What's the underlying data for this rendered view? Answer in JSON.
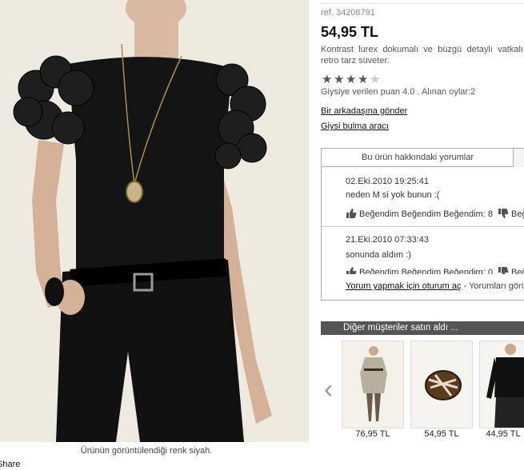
{
  "product": {
    "ref": "ref. 34208791",
    "price": "54,95 TL",
    "description": "Kontrast lurex dokumalı ve büzgü detaylı vatkalı, retro tarz süveter.",
    "rating_stars": 4,
    "rating_max": 5,
    "rating_text": "Giysiye verilen puan 4.0 . Alınan oylar:2",
    "send_friend_link": "Bir arkadaşına gönder",
    "finder_link": "Giysi bulma aracı",
    "image_caption": "Ürünün görüntülendiği renk siyah."
  },
  "share_label": "Share",
  "reviews": {
    "tab_label": "Bu ürün hakkındaki yorumlar",
    "items": [
      {
        "date": "02.Eki.2010 19:25:41",
        "text": "neden M si yok bunun :(",
        "likes": "Beğendim Beğendim Beğendim: 8",
        "dislikes": "Beğ"
      },
      {
        "date": "21.Eki.2010 07:33:43",
        "text": "sonunda aldım :)",
        "likes": "Beğendim Beğendim Beğendim: 0",
        "dislikes": "Beğ"
      }
    ],
    "login_link": "Yorum yapmak için oturum aç",
    "login_suffix": " - Yorumları görü"
  },
  "others": {
    "title": "Diğer müşteriler satın aldı ...",
    "prev_arrow": "‹",
    "products": [
      {
        "price": "76,95 TL",
        "kind": "dress"
      },
      {
        "price": "54,95 TL",
        "kind": "bag"
      },
      {
        "price": "44,95 TL",
        "kind": "top"
      }
    ]
  },
  "colors": {
    "bar": "#555555",
    "background_photo": "#efeae0"
  }
}
